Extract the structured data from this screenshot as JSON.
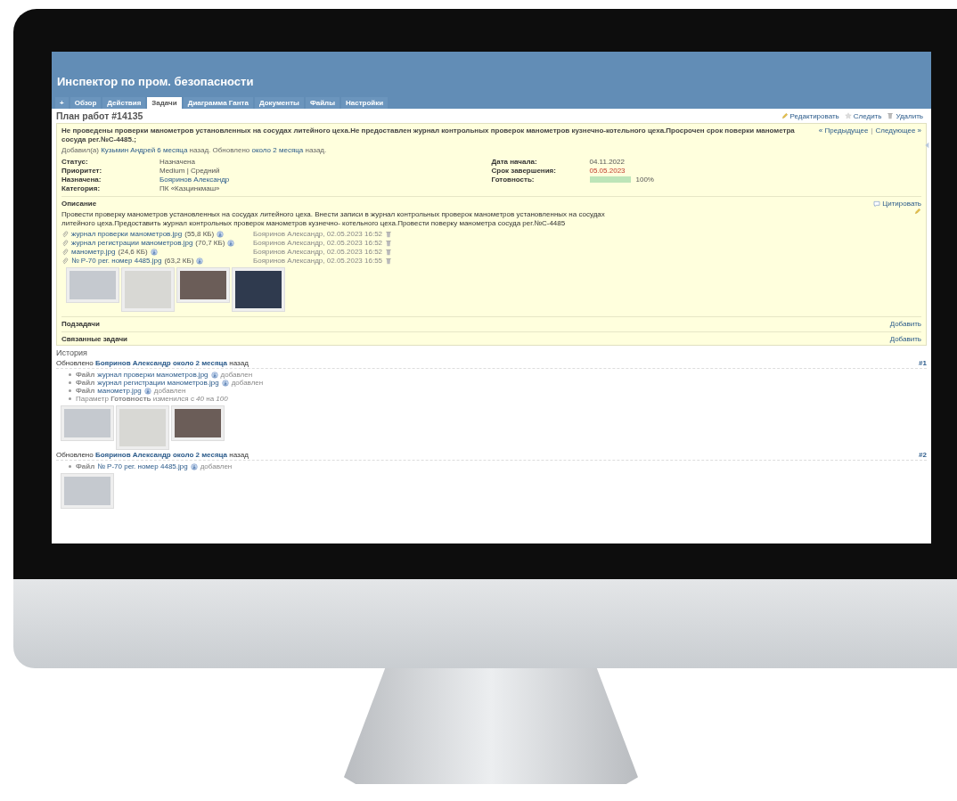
{
  "header": {
    "title": "Инспектор по пром. безопасности"
  },
  "tabs": [
    {
      "label": "+",
      "selected": false
    },
    {
      "label": "Обзор",
      "selected": false
    },
    {
      "label": "Действия",
      "selected": false
    },
    {
      "label": "Задачи",
      "selected": true
    },
    {
      "label": "Диаграмма Ганта",
      "selected": false
    },
    {
      "label": "Документы",
      "selected": false
    },
    {
      "label": "Файлы",
      "selected": false
    },
    {
      "label": "Настройки",
      "selected": false
    }
  ],
  "issue": {
    "heading": "План работ #14135",
    "actions": [
      {
        "kind": "edit",
        "label": "Редактировать"
      },
      {
        "kind": "watch",
        "label": "Следить"
      },
      {
        "kind": "delete",
        "label": "Удалить"
      }
    ],
    "subject": "Не проведены проверки манометров установленных на сосудах литейного цеха.Не предоставлен журнал контрольных проверок манометров кузнечно-котельного цеха.Просрочен срок поверки манометра сосуда рег.№С-4485.;",
    "nav": {
      "prev": "« Предыдущее",
      "separator": "|",
      "next": "Следующее »"
    },
    "author_line": [
      {
        "text": "Добавил(а) ",
        "kind": "text"
      },
      {
        "text": "Кузьмин Андрей",
        "kind": "link"
      },
      {
        "text": "6 месяца",
        "kind": "link"
      },
      {
        "text": " назад. Обновлено ",
        "kind": "text"
      },
      {
        "text": "около 2 месяца",
        "kind": "link"
      },
      {
        "text": " назад.",
        "kind": "text"
      }
    ],
    "attributes_left": [
      {
        "label": "Статус:",
        "value": "Назначена",
        "kind": "text"
      },
      {
        "label": "Приоритет:",
        "value": "Medium | Средний",
        "kind": "text"
      },
      {
        "label": "Назначена:",
        "value": "Бояринов Александр",
        "kind": "link"
      },
      {
        "label": "Категория:",
        "value": "ПК «Казцинкмаш»",
        "kind": "text"
      }
    ],
    "attributes_right": [
      {
        "label": "Дата начала:",
        "value": "04.11.2022",
        "kind": "text"
      },
      {
        "label": "Срок завершения:",
        "value": "05.05.2023",
        "kind": "overdue"
      },
      {
        "label": "Готовность:",
        "kind": "progress",
        "level": 1,
        "reading": "100%"
      }
    ],
    "description": {
      "title": "Описание",
      "quote": "Цитировать",
      "text": "Провести проверку манометров установленных на сосудах литейного цеха. Внести записи в журнал контрольных проверок манометров установленных на сосудах литейного цеха.Предоставить журнал контрольных проверок манометров кузнечно- котельного цеха.Провести поверку манометра сосуда рег.№С-4485"
    },
    "attachments": [
      {
        "name": "журнал проверки манометров.jpg",
        "size": "(55,8 КБ)",
        "author": "Бояринов Александр, 02.05.2023 16:52",
        "thumbnail": true
      },
      {
        "name": "журнал регистрации манометров.jpg",
        "size": "(70,7 КБ)",
        "author": "Бояринов Александр, 02.05.2023 16:52",
        "thumbnail": true
      },
      {
        "name": "манометр.jpg",
        "size": "(24,6 КБ)",
        "author": "Бояринов Александр, 02.05.2023 16:52",
        "thumbnail": true
      },
      {
        "name": "№ Р-70 рег. номер 4485.jpg",
        "size": "(63,2 КБ)",
        "author": "Бояринов Александр, 02.05.2023 16:55",
        "thumbnail": true
      }
    ],
    "sections": [
      {
        "title": "Подзадачи",
        "action": "Добавить"
      },
      {
        "title": "Связанные задачи",
        "action": "Добавить"
      }
    ]
  },
  "history": {
    "title": "История",
    "journals": [
      {
        "header": [
          {
            "text": "Обновлено ",
            "kind": "text"
          },
          {
            "text": "Бояринов Александр",
            "kind": "link"
          },
          {
            "text": "около 2 месяца",
            "kind": "link"
          },
          {
            "text": " назад",
            "kind": "text"
          }
        ],
        "number": "#1",
        "details": [
          {
            "kind": "file",
            "label": "Файл",
            "value": "журнал проверки манометров.jpg",
            "status": "добавлен",
            "thumbnail": true
          },
          {
            "kind": "file",
            "label": "Файл",
            "value": "журнал регистрации манометров.jpg",
            "status": "добавлен",
            "thumbnail": true
          },
          {
            "kind": "file",
            "label": "Файл",
            "value": "манометр.jpg",
            "status": "добавлен",
            "thumbnail": true
          },
          {
            "kind": "param",
            "text": "Параметр **Готовность** изменился с *40* на *100*"
          }
        ]
      },
      {
        "header": [
          {
            "text": "Обновлено ",
            "kind": "text"
          },
          {
            "text": "Бояринов Александр",
            "kind": "link"
          },
          {
            "text": "около 2 месяца",
            "kind": "link"
          },
          {
            "text": " назад",
            "kind": "text"
          }
        ],
        "number": "#2",
        "details": [
          {
            "kind": "file",
            "label": "Файл",
            "value": "№ Р-70 рег. номер 4485.jpg",
            "status": "добавлен",
            "thumbnail": true
          }
        ]
      }
    ]
  }
}
